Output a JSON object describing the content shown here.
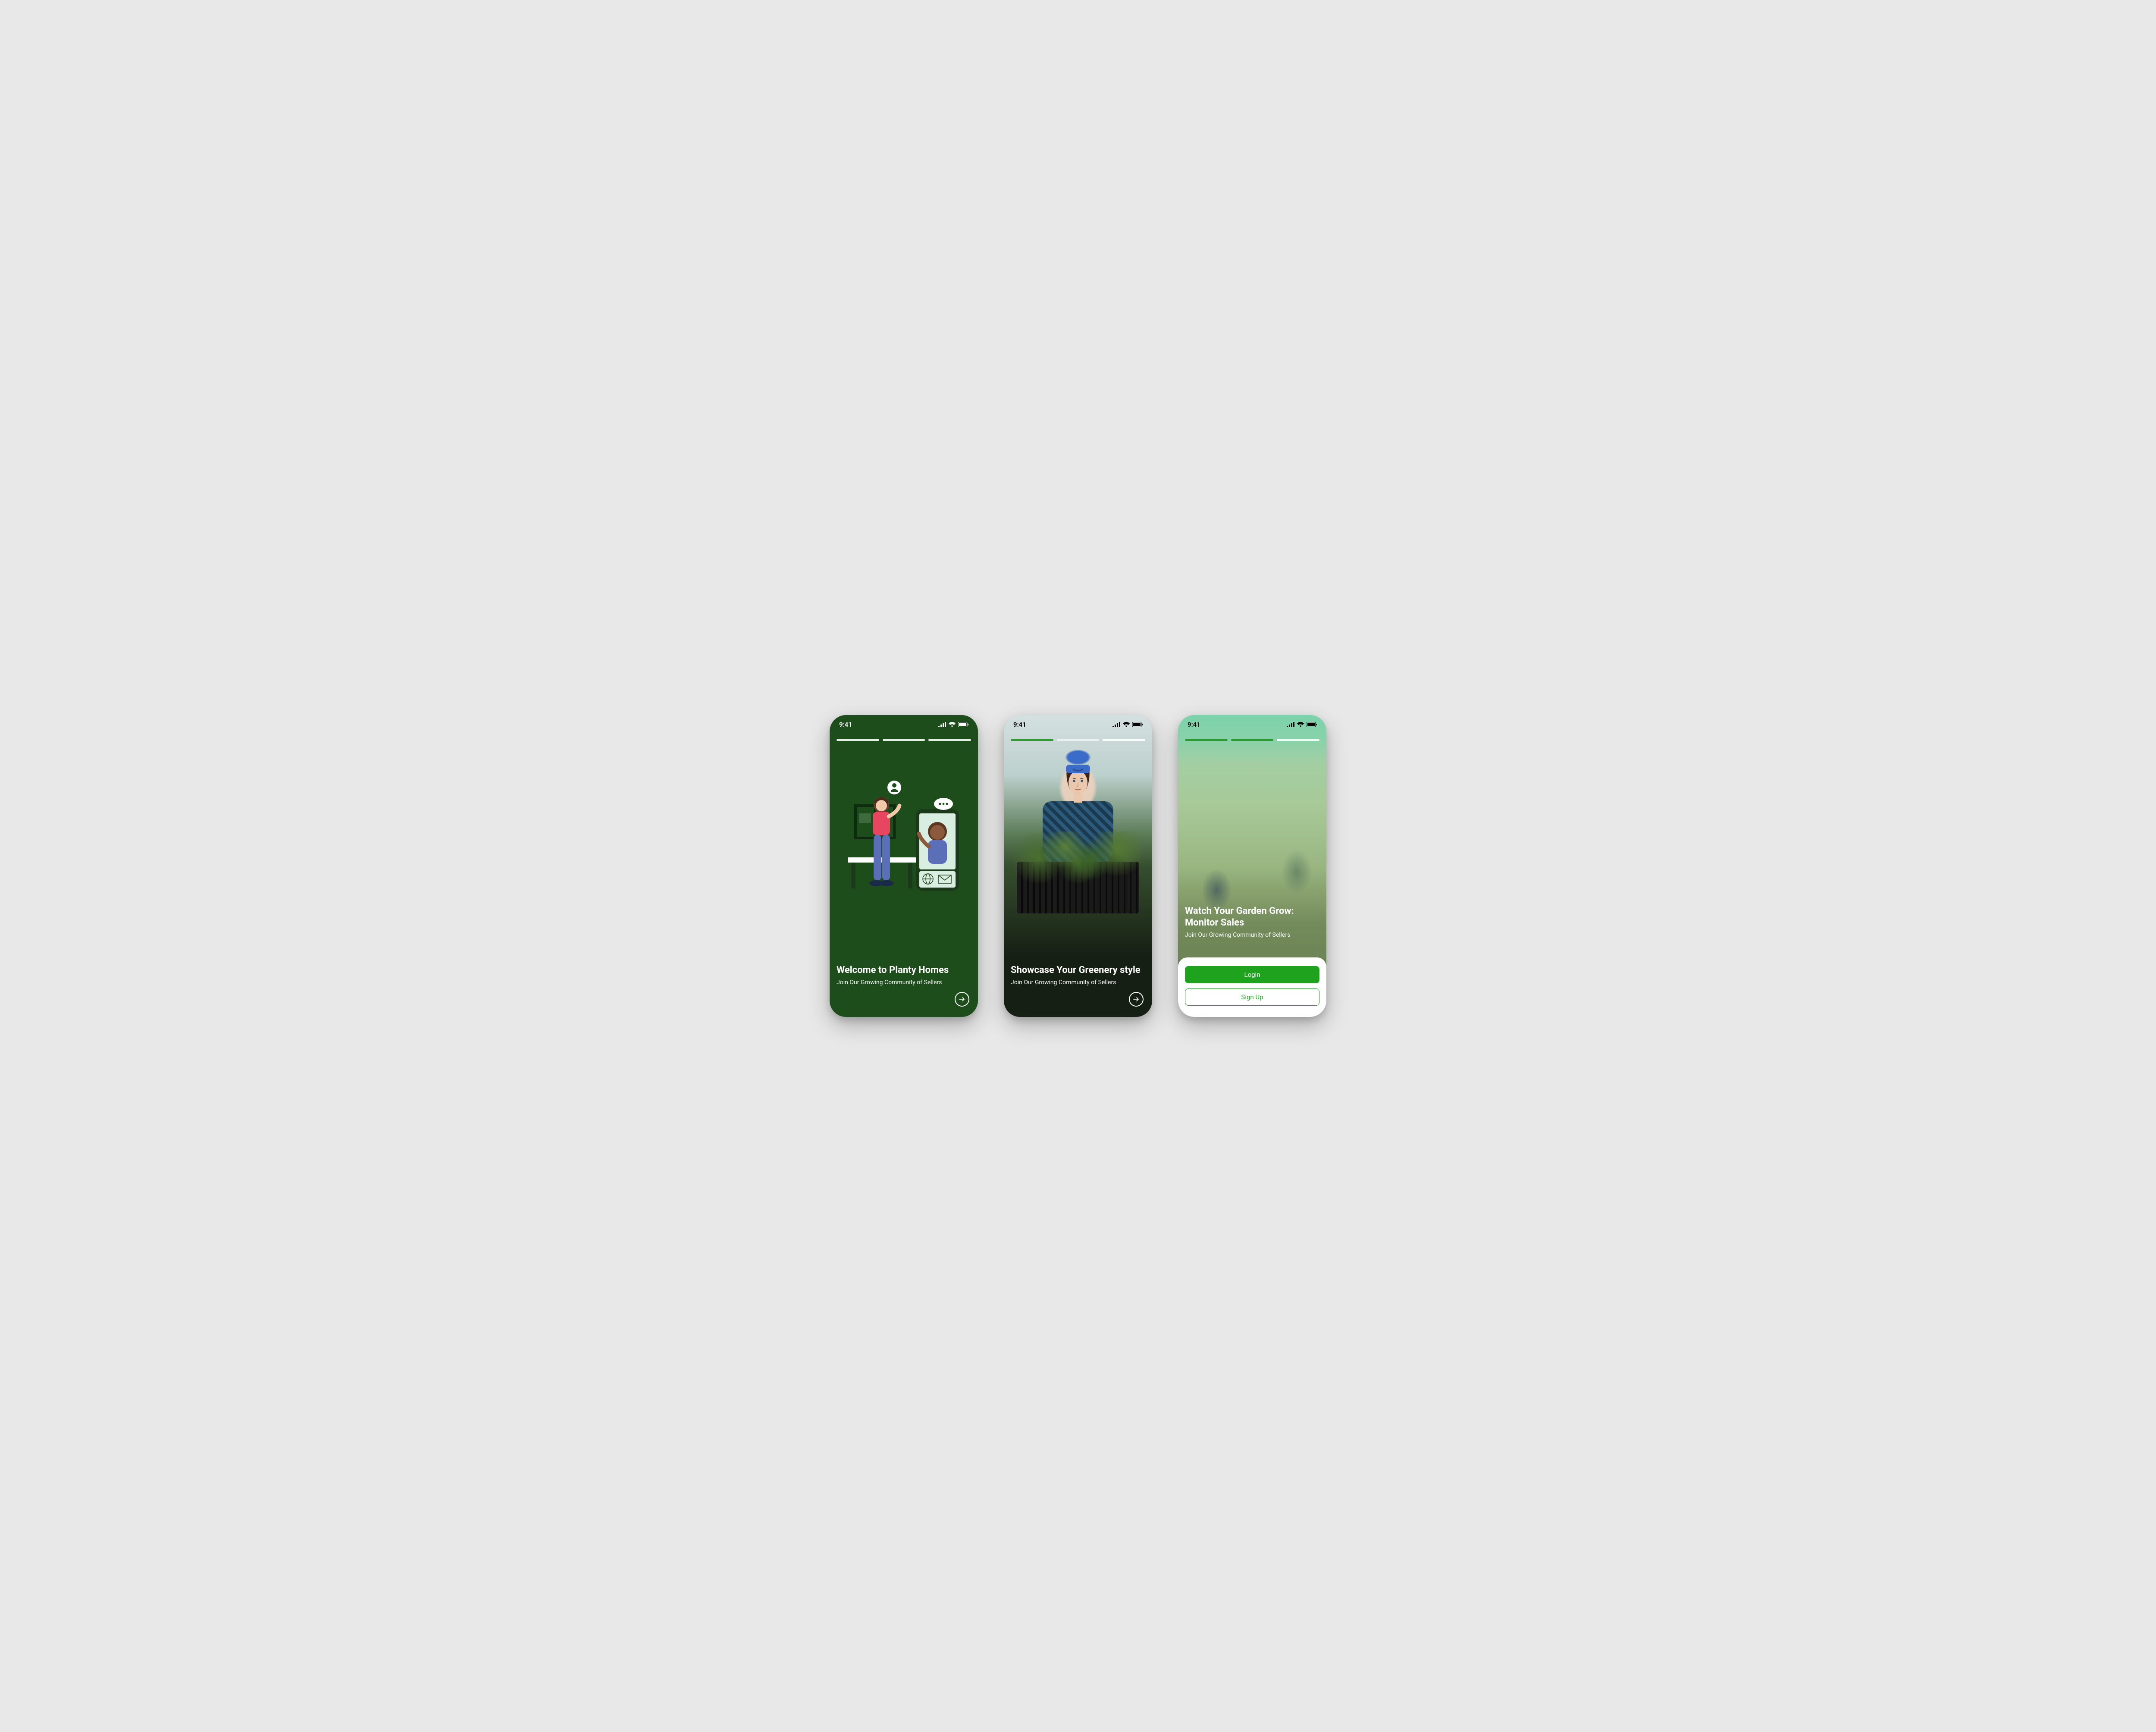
{
  "status": {
    "time": "9:41"
  },
  "screens": [
    {
      "title": "Welcome to Planty Homes",
      "subtitle": "Join Our Growing Community of Sellers"
    },
    {
      "title": "Showcase Your Greenery style",
      "subtitle": "Join Our Growing Community of Sellers"
    },
    {
      "title": "Watch Your Garden Grow: Monitor Sales",
      "subtitle": "Join Our Growing Community of Sellers",
      "login_label": "Login",
      "signup_label": "Sign Up"
    }
  ],
  "colors": {
    "brand_green": "#1fa31f",
    "dark_green": "#1d4d1b"
  }
}
